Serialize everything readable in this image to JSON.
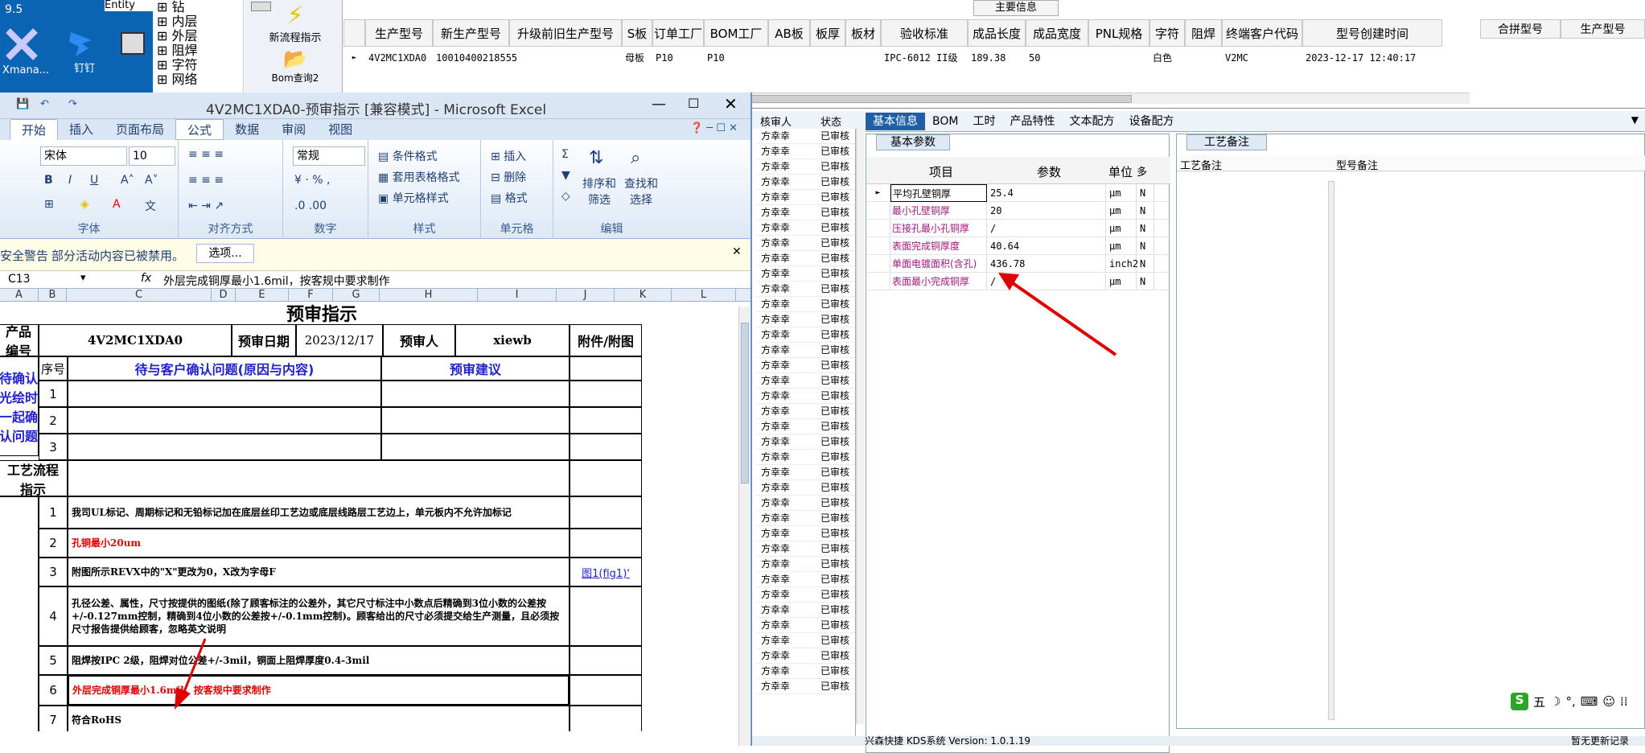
{
  "desktop": {
    "icons": [
      {
        "label": "Xmana..."
      },
      {
        "label": "钉钉"
      },
      {
        "label": "Entity"
      },
      {
        "label": "9.5"
      }
    ]
  },
  "tree": {
    "items": [
      "钻",
      "内层",
      "外层",
      "阻焊",
      "字符",
      "网络"
    ]
  },
  "toolbar": {
    "new_flow": "新流程指示",
    "bom_query": "Bom查询2"
  },
  "main_grid": {
    "banner": "主要信息",
    "columns": [
      "生产型号",
      "新生产型号",
      "升级前旧生产型号",
      "S板",
      "订单工厂",
      "BOM工厂",
      "AB板",
      "板厚",
      "板材",
      "验收标准",
      "成品长度",
      "成品宽度",
      "PNL规格",
      "字符",
      "阻焊",
      "终端客户代码",
      "型号创建时间"
    ],
    "right_columns": [
      "合拼型号",
      "生产型号"
    ],
    "row": [
      "4V2MC1XDA0",
      "10010400218555",
      "",
      "母板",
      "P10",
      "P10",
      "",
      "",
      "",
      "IPC-6012 II级",
      "189.38",
      "50",
      "",
      "白色",
      "",
      "V2MC",
      "2023-12-17 12:40:17"
    ]
  },
  "excel": {
    "title": "4V2MC1XDA0-预审指示 [兼容模式] - Microsoft Excel",
    "tabs": [
      "开始",
      "插入",
      "页面布局",
      "公式",
      "数据",
      "审阅",
      "视图"
    ],
    "font_name": "宋体",
    "font_size": "10",
    "number_format": "常规",
    "groups": [
      "字体",
      "对齐方式",
      "数字",
      "样式",
      "单元格",
      "编辑"
    ],
    "style_buttons": [
      "条件格式",
      "套用表格格式",
      "单元格样式"
    ],
    "cell_buttons": [
      "插入",
      "删除",
      "格式"
    ],
    "edit_buttons": [
      "排序和\n筛选",
      "查找和\n选择"
    ],
    "security_label": "安全警告",
    "security_text": "部分活动内容已被禁用。",
    "options_label": "选项...",
    "name_box": "C13",
    "formula": "外层完成铜厚最小1.6mil，按客规中要求制作",
    "col_headers": [
      "A",
      "B",
      "C",
      "D",
      "E",
      "F",
      "G",
      "H",
      "I",
      "J",
      "K",
      "L"
    ],
    "sheet": {
      "title": "预审指示",
      "product_label": "产品\n编号",
      "product_no": "4V2MC1XDA0",
      "date_label": "预审日期",
      "date": "2023/12/17",
      "reviewer_label": "预审人",
      "reviewer": "xiewb",
      "attach_label": "附件/附图",
      "confirm_side": "待确认\n光绘时\n一起确\n认问题",
      "seq_label": "序号",
      "issue_header": "待与客户确认问题(原因与内容)",
      "suggest_header": "预审建议",
      "confirm_rows": [
        "1",
        "2",
        "3"
      ],
      "process_label": "工艺流程\n指示",
      "process_rows": [
        {
          "no": "1",
          "text": "我司UL标记、周期标记和无铅标记加在底层丝印工艺边或底层线路层工艺边上，单元板内不允许加标记",
          "attach": ""
        },
        {
          "no": "2",
          "text": "孔铜最小20um",
          "attach": ""
        },
        {
          "no": "3",
          "text": "附图所示REVX中的\"X\"更改为0，X改为字母F",
          "attach": "图1(fig1)'"
        },
        {
          "no": "4",
          "text": "孔径公差、属性，尺寸按提供的图纸(除了顾客标注的公差外，其它尺寸标注中小数点后精确到3位小数的公差按+/-0.127mm控制，精确到4位小数的公差按+/-0.1mm控制)。顾客给出的尺寸必须提交给生产测量，且必须按尺寸报告提供给顾客，忽略英文说明",
          "attach": ""
        },
        {
          "no": "5",
          "text": "阻焊按IPC 2级，阻焊对位公差+/-3mil，铜面上阻焊厚度0.4-3mil",
          "attach": ""
        },
        {
          "no": "6",
          "text": "外层完成铜厚最小1.6mil，按客规中要求制作",
          "attach": ""
        },
        {
          "no": "7",
          "text": "符合RoHS",
          "attach": ""
        }
      ]
    }
  },
  "approvals": {
    "header_reviewer": "核审人",
    "header_status": "状态",
    "reviewer": "方幸幸",
    "status": "已审核",
    "count": 37
  },
  "basic_info": {
    "tabs": [
      "基本信息",
      "BOM",
      "工时",
      "产品特性",
      "文本配方",
      "设备配方"
    ],
    "section": "基本参数",
    "headers": [
      "项目",
      "参数",
      "单位",
      "多"
    ],
    "rows": [
      {
        "item": "平均孔壁铜厚",
        "value": "25.4",
        "unit": "μm",
        "flag": "N"
      },
      {
        "item": "最小孔壁铜厚",
        "value": "20",
        "unit": "μm",
        "flag": "N"
      },
      {
        "item": "压接孔最小孔铜厚",
        "value": "/",
        "unit": "μm",
        "flag": "N"
      },
      {
        "item": "表面完成铜厚度",
        "value": "40.64",
        "unit": "μm",
        "flag": "N"
      },
      {
        "item": "单面电镀面积(含孔)",
        "value": "436.78",
        "unit": "inch2",
        "flag": "N"
      },
      {
        "item": "表面最小完成铜厚",
        "value": "/",
        "unit": "μm",
        "flag": "N"
      }
    ]
  },
  "craft_note": {
    "section": "工艺备注",
    "col1": "工艺备注",
    "col2": "型号备注"
  },
  "statusbar": {
    "text": "兴森快捷 KDS系统 Version: 1.0.1.19",
    "right": "暂无更新记录"
  },
  "ime": {
    "label": "五"
  },
  "colors": {
    "red": "#e00000",
    "blue": "#2222cc",
    "purple": "#9b1b7b",
    "accent": "#1f5fa8"
  }
}
